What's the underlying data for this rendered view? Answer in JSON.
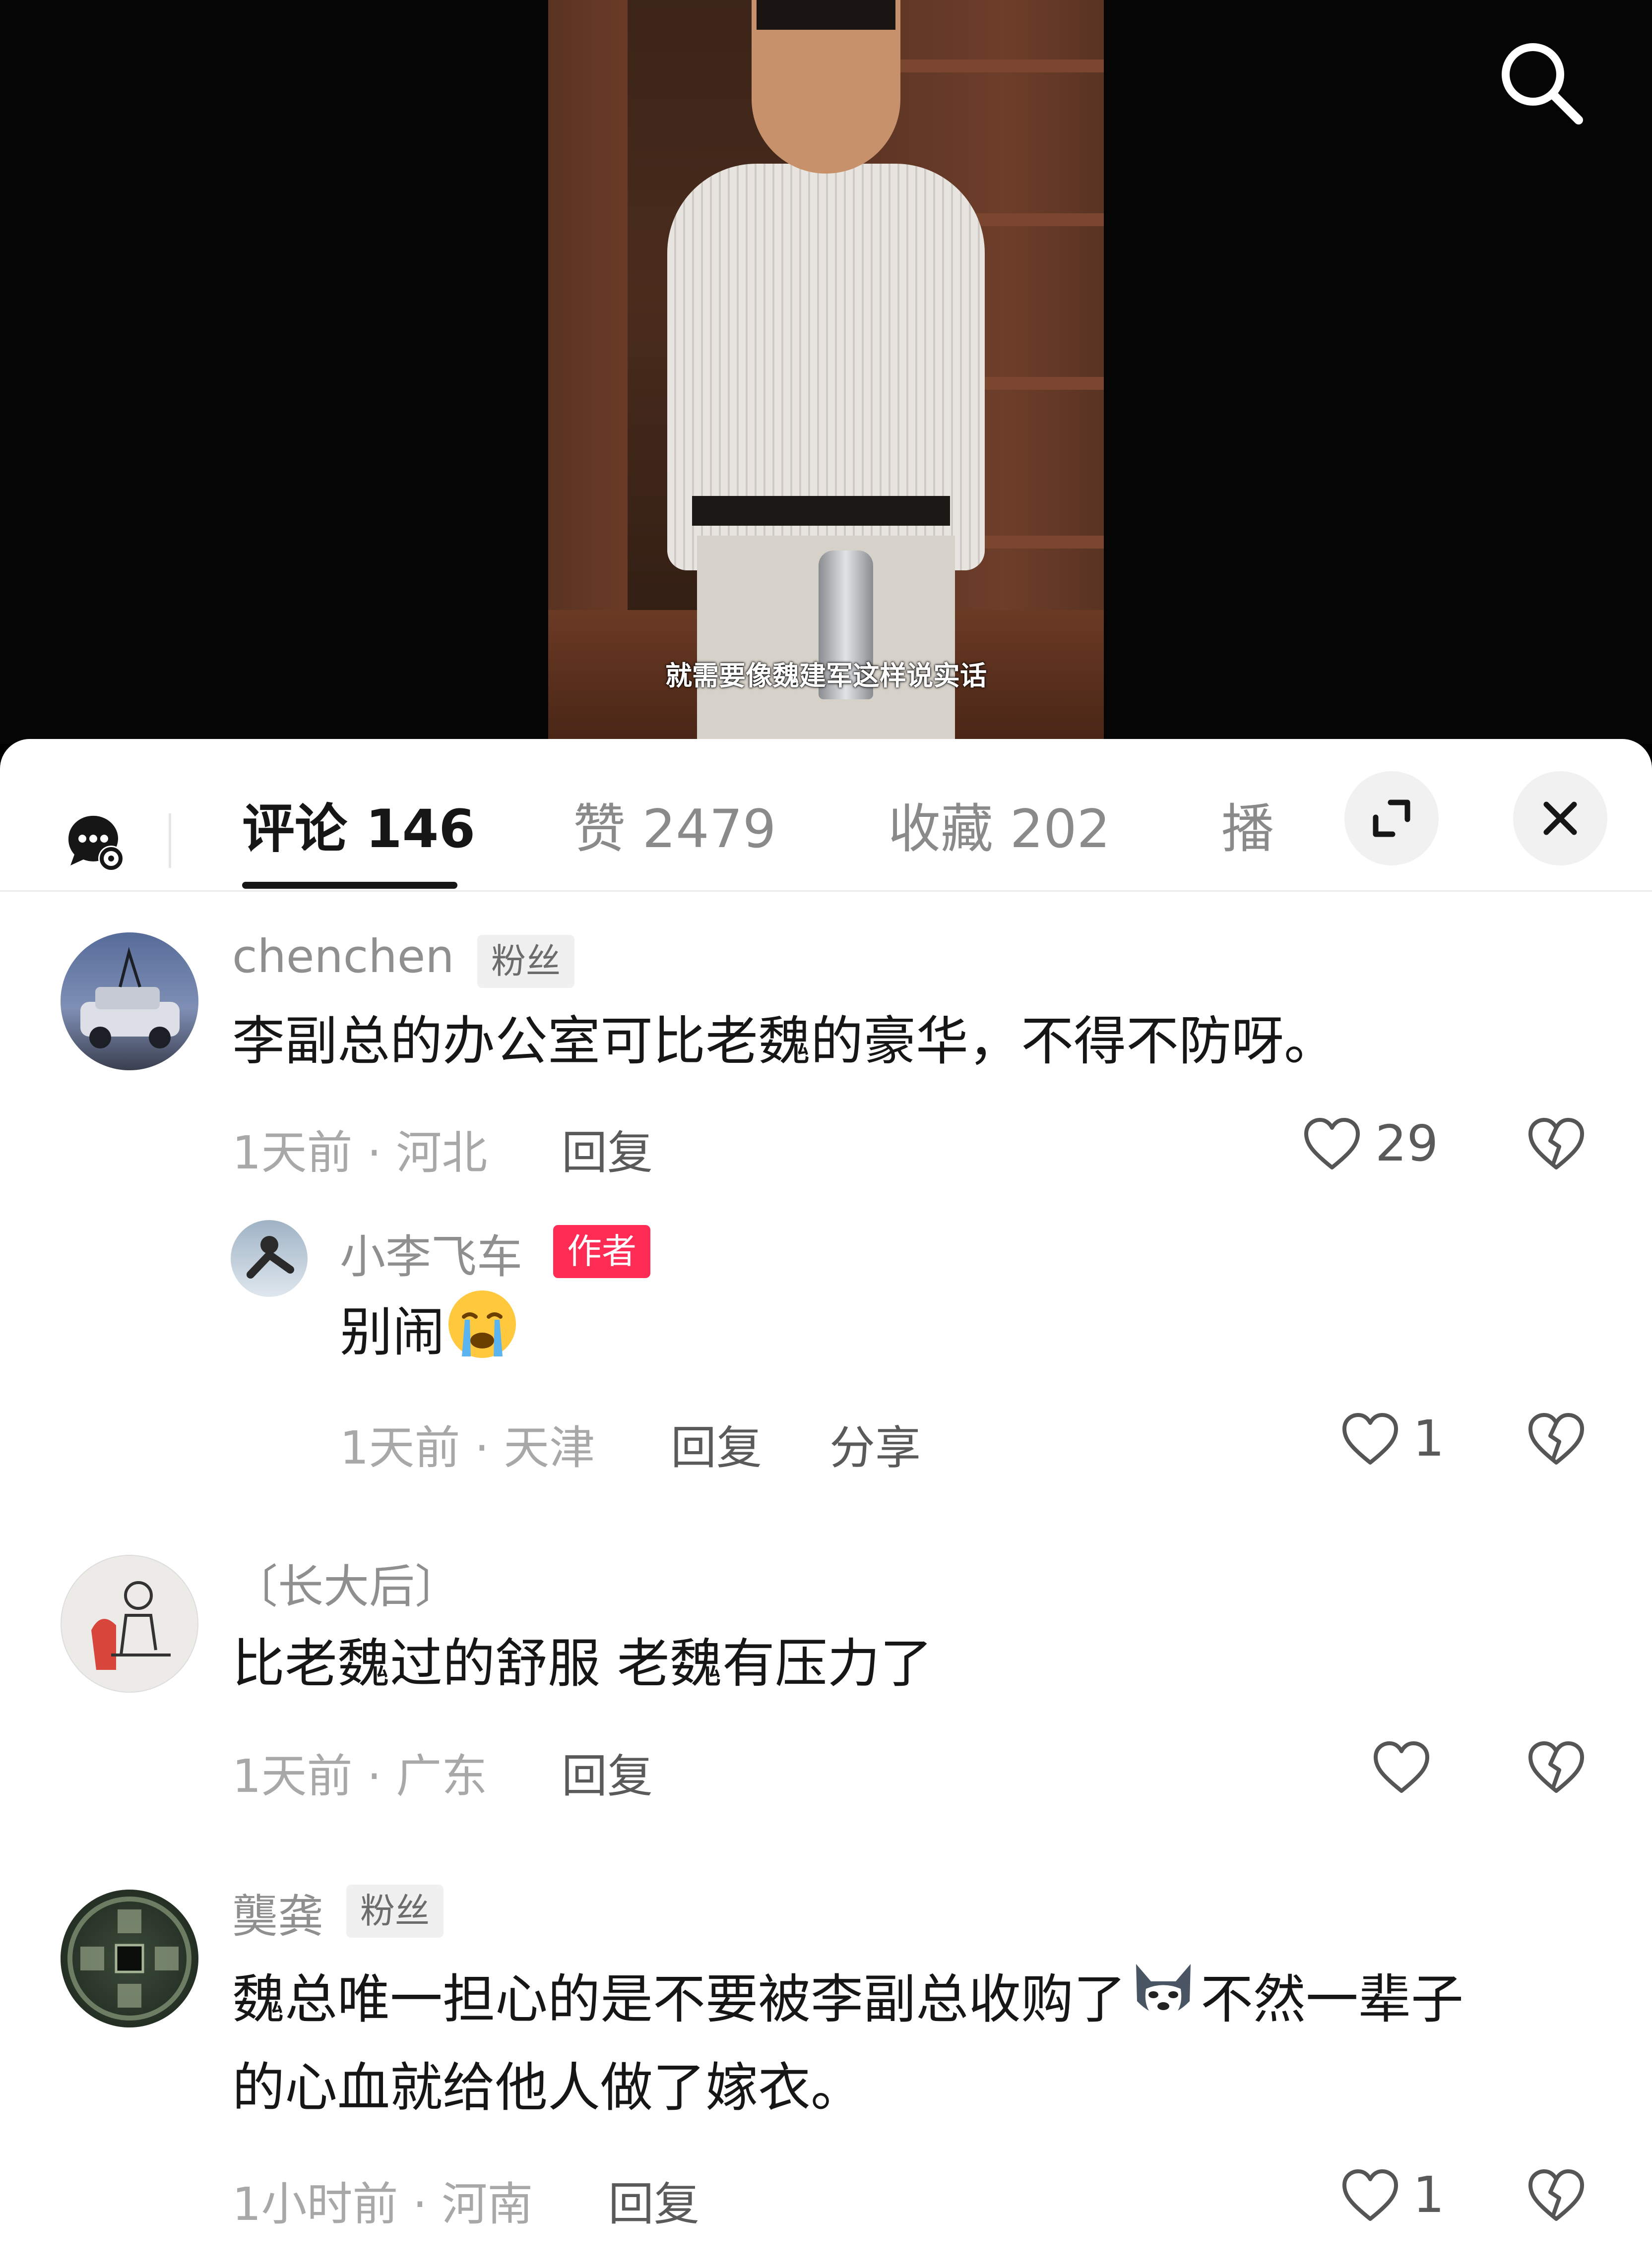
{
  "video": {
    "subtitle": "就需要像魏建军这样说实话"
  },
  "tabs": [
    {
      "label": "评论 146",
      "active": true
    },
    {
      "label": "赞 2479",
      "active": false
    },
    {
      "label": "收藏 202",
      "active": false
    },
    {
      "label": "播",
      "active": false
    }
  ],
  "icons": {
    "search": "search-icon",
    "dm": "chat-settings-icon",
    "expand": "expand-icon",
    "close": "close-icon",
    "like": "heart-icon",
    "dislike": "broken-heart-icon"
  },
  "comments": [
    {
      "user": "chenchen",
      "badge": "粉丝",
      "text": "李副总的办公室可比老魏的豪华，不得不防呀。",
      "meta": "1天前 · 河北",
      "reply": "回复",
      "likes": "29",
      "replies": [
        {
          "user": "小李飞车",
          "badge": "作者",
          "text": "别闹",
          "emoji": "crying-face",
          "meta": "1天前 · 天津",
          "reply": "回复",
          "share": "分享",
          "likes": "1"
        }
      ]
    },
    {
      "user": "〔长大后〕",
      "text": "比老魏过的舒服 老魏有压力了",
      "meta": "1天前 · 广东",
      "reply": "回复",
      "likes": ""
    },
    {
      "user": "龑龚",
      "badge": "粉丝",
      "text_line1_a": "魏总唯一担心的是不要被李副总收购了",
      "emoji": "husky-dog-face",
      "text_line1_b": "不然一辈子",
      "text_line2": "的心血就给他人做了嫁衣。",
      "meta": "1小时前 · 河南",
      "reply": "回复",
      "likes": "1"
    }
  ],
  "colors": {
    "accent_author_badge": "#fe2c55",
    "text_primary": "#161616",
    "text_secondary": "#8f8f8f"
  }
}
